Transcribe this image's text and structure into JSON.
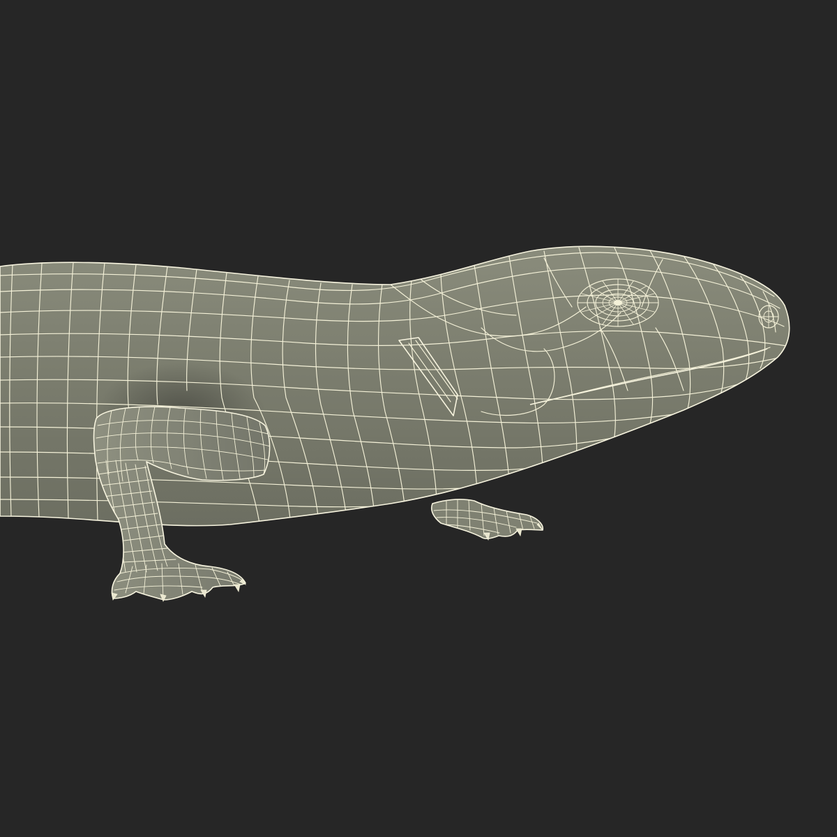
{
  "scene": {
    "subject": "lizard-wireframe-model",
    "background_color": "#262626",
    "surface_color": "#7b7d6e",
    "wire_color": "#f4f1d8"
  }
}
